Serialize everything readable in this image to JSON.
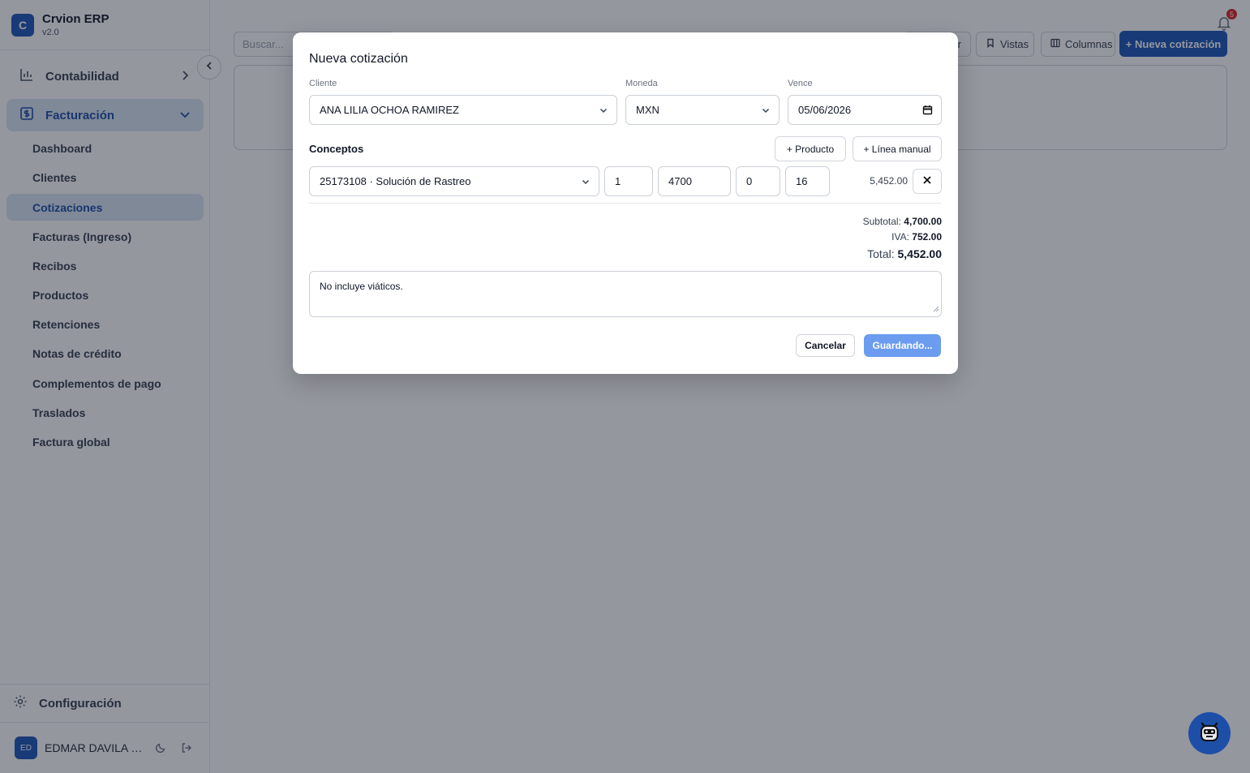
{
  "app": {
    "name": "Crvion ERP",
    "version": "v2.0",
    "logo_letter": "C"
  },
  "sidebar": {
    "groups": [
      {
        "label": "Contabilidad",
        "icon": "bar-chart-icon",
        "expanded": false
      },
      {
        "label": "Facturación",
        "icon": "invoice-icon",
        "expanded": true
      }
    ],
    "items": [
      {
        "label": "Dashboard"
      },
      {
        "label": "Clientes"
      },
      {
        "label": "Cotizaciones",
        "active": true
      },
      {
        "label": "Facturas (Ingreso)"
      },
      {
        "label": "Recibos"
      },
      {
        "label": "Productos"
      },
      {
        "label": "Retenciones"
      },
      {
        "label": "Notas de crédito"
      },
      {
        "label": "Complementos de pago"
      },
      {
        "label": "Traslados"
      },
      {
        "label": "Factura global"
      }
    ],
    "config_label": "Configuración",
    "user": {
      "initials": "ED",
      "name": "EDMAR DAVILA R..."
    }
  },
  "toolbar": {
    "search_placeholder": "Buscar...",
    "partial_button": "r",
    "views_label": "Vistas",
    "columns_label": "Columnas",
    "new_label": "+ Nueva cotización"
  },
  "notifications": {
    "count": "5"
  },
  "modal": {
    "title": "Nueva cotización",
    "client": {
      "label": "Cliente",
      "value": "ANA LILIA OCHOA RAMIREZ"
    },
    "currency": {
      "label": "Moneda",
      "value": "MXN"
    },
    "due": {
      "label": "Vence",
      "value": "05/06/2026"
    },
    "concepts_title": "Conceptos",
    "add_product_label": "+ Producto",
    "add_manual_label": "+ Línea manual",
    "line": {
      "product": "25173108 · Solución de Rastreo",
      "quantity": "1",
      "price": "4700",
      "discount": "0",
      "tax": "16",
      "total": "5,452.00"
    },
    "totals": {
      "subtotal_label": "Subtotal:",
      "subtotal": "4,700.00",
      "iva_label": "IVA:",
      "iva": "752.00",
      "total_label": "Total:",
      "total": "5,452.00"
    },
    "notes": "No incluye viáticos.",
    "cancel_label": "Cancelar",
    "save_label": "Guardando..."
  },
  "colors": {
    "accent": "#1e56b8",
    "active_bg": "#dbe5f4",
    "save_disabled": "#6b9cf0"
  }
}
